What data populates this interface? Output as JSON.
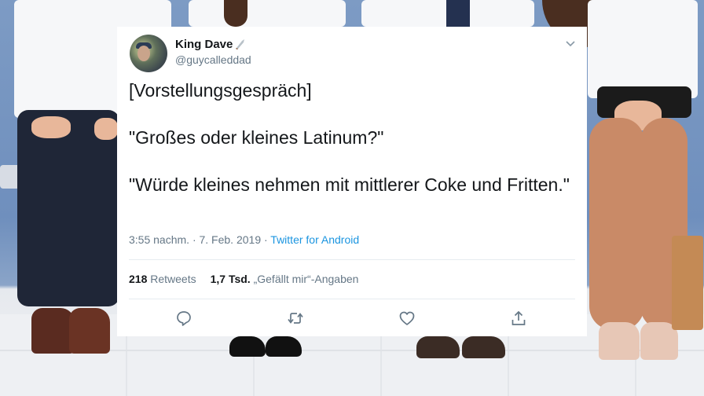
{
  "tweet": {
    "display_name": "King Dave",
    "handle": "@guycalleddad",
    "paragraphs": [
      "[Vorstellungsgespräch]",
      "\"Großes oder kleines Latinum?\"",
      "\"Würde kleines nehmen mit mittlerer Coke und Fritten.\""
    ],
    "timestamp": "3:55 nachm. · 7. Feb. 2019 · ",
    "source": "Twitter for Android",
    "retweets_count": "218",
    "retweets_label": "Retweets",
    "likes_count": "1,7 Tsd.",
    "likes_label": "„Gefällt mir“-Angaben"
  },
  "icons": {
    "name_badge": "knife-emoji-icon",
    "menu": "chevron-down-icon",
    "reply": "reply-icon",
    "retweet": "retweet-icon",
    "like": "heart-icon",
    "share": "share-icon"
  },
  "colors": {
    "text": "#14171a",
    "secondary": "#657786",
    "link": "#1b95e0",
    "card_bg": "#ffffff"
  }
}
